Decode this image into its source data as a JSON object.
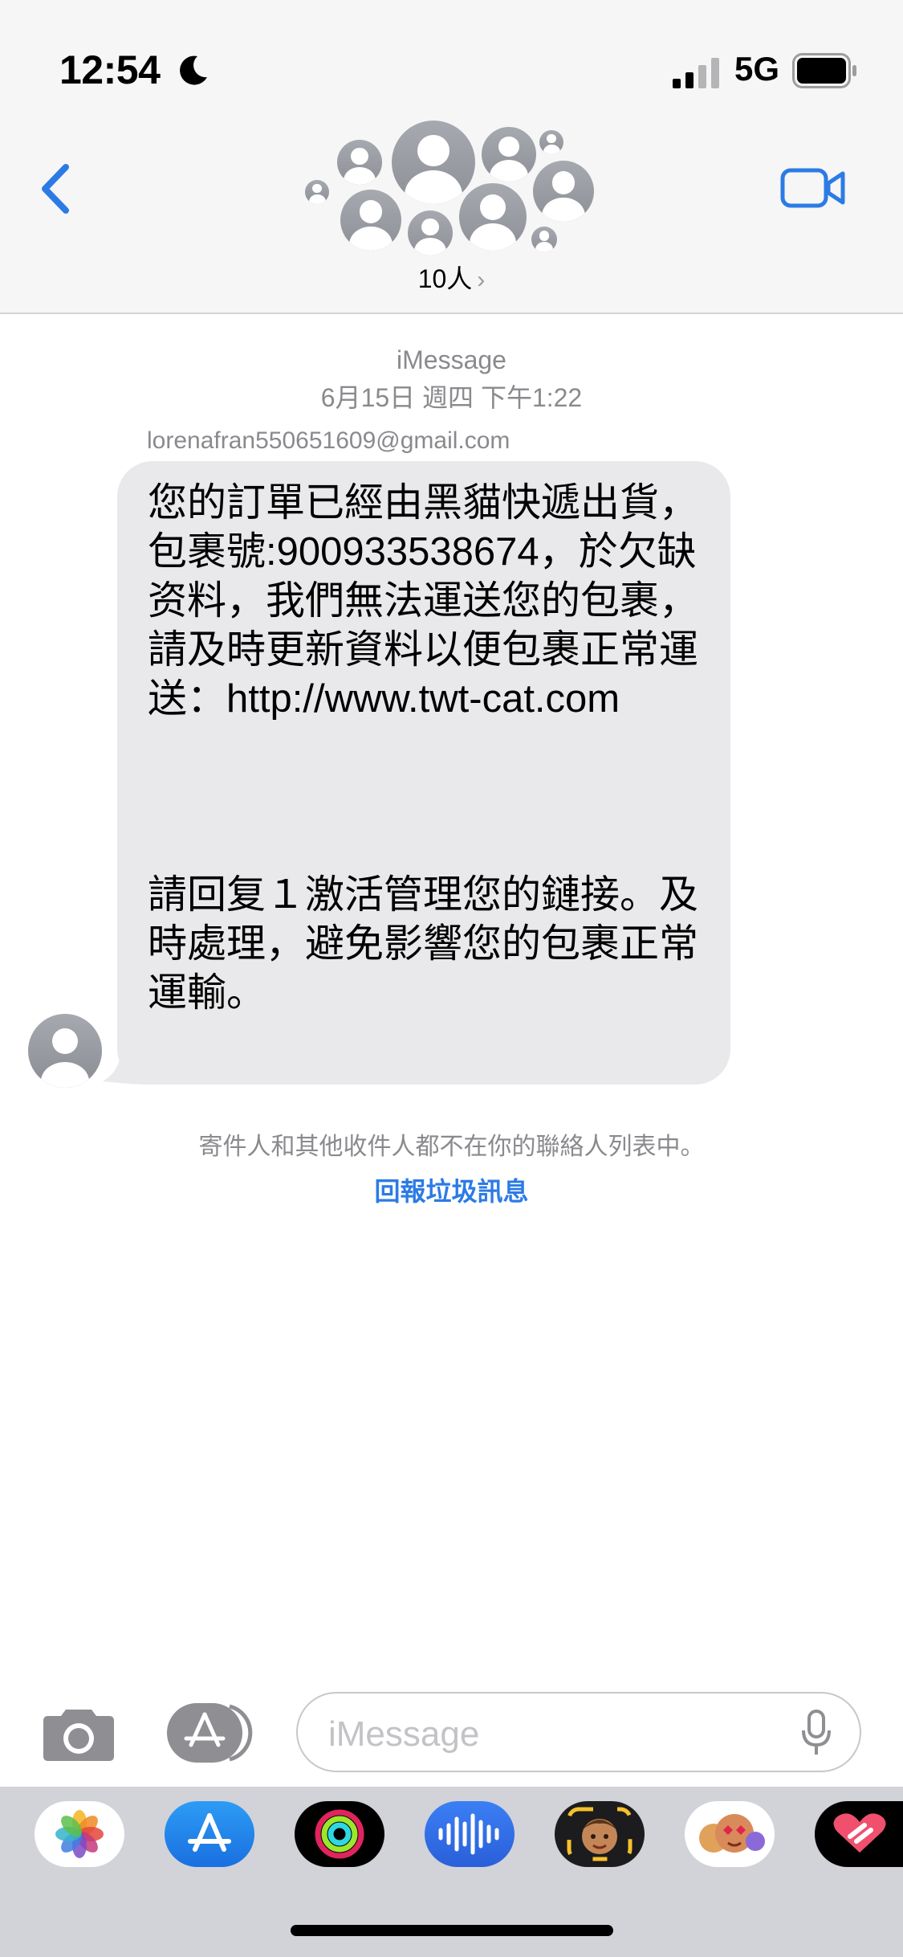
{
  "status_bar": {
    "time": "12:54",
    "network": "5G"
  },
  "header": {
    "group_count": "10人",
    "chevron": "›"
  },
  "conversation": {
    "service": "iMessage",
    "timestamp": "6月15日 週四 下午1:22",
    "sender": "lorenafran550651609@gmail.com",
    "message_part1": "您的訂單已經由黑貓快遞出貨，包裹號:900933538674，於欠缺资料，我們無法運送您的包裹，請及時更新資料以便包裹正常運送：http://www.twt-cat.com",
    "message_part2": "請回复１激活管理您的鏈接。及時處理，避免影響您的包裹正常運輸。",
    "notice": "寄件人和其他收件人都不在你的聯絡人列表中。",
    "report_link": "回報垃圾訊息"
  },
  "input_bar": {
    "placeholder": "iMessage"
  },
  "app_drawer": {
    "apps": [
      "photos-app-icon",
      "app-store-app-icon",
      "activity-app-icon",
      "audio-message-app-icon",
      "memoji-app-icon",
      "memoji-stickers-app-icon",
      "digital-touch-app-icon"
    ]
  },
  "colors": {
    "accent": "#2c7be5",
    "bubble": "#e9e9eb",
    "header_bg": "#f6f6f6",
    "drawer_bg": "#d1d3d9"
  }
}
